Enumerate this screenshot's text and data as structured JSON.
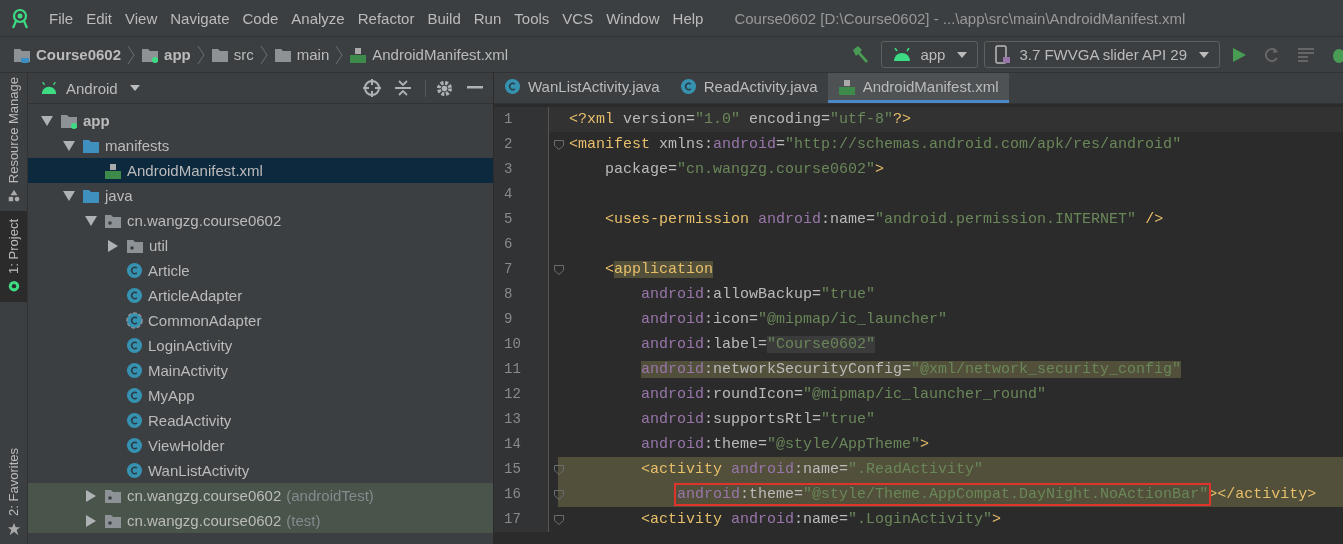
{
  "menu_bar": {
    "items": [
      "File",
      "Edit",
      "View",
      "Navigate",
      "Code",
      "Analyze",
      "Refactor",
      "Build",
      "Run",
      "Tools",
      "VCS",
      "Window",
      "Help"
    ],
    "title": "Course0602 [D:\\Course0602] - ...\\app\\src\\main\\AndroidManifest.xml"
  },
  "nav_bar": {
    "breadcrumbs": [
      {
        "label": "Course0602",
        "kind": "project"
      },
      {
        "label": "app",
        "kind": "module"
      },
      {
        "label": "src",
        "kind": "folder"
      },
      {
        "label": "main",
        "kind": "folder"
      },
      {
        "label": "AndroidManifest.xml",
        "kind": "manifest"
      }
    ],
    "run_config": "app",
    "device": "3.7  FWVGA slider API 29"
  },
  "tool_strip": [
    {
      "label": "Resource Manage",
      "kind": "resources",
      "selected": false
    },
    {
      "label": "1: Project",
      "kind": "project",
      "selected": true
    },
    {
      "label": "2: Favorites",
      "kind": "favorites",
      "selected": false
    }
  ],
  "project_panel": {
    "view": "Android",
    "tree": [
      {
        "label": "app",
        "kind": "module",
        "expanded": true,
        "selected": false,
        "test_scope": false,
        "children": [
          {
            "label": "manifests",
            "kind": "folder",
            "expanded": true,
            "selected": false,
            "test_scope": false,
            "children": [
              {
                "label": "AndroidManifest.xml",
                "kind": "manifest",
                "selected": true,
                "test_scope": false
              }
            ]
          },
          {
            "label": "java",
            "kind": "folder",
            "expanded": true,
            "selected": false,
            "test_scope": false,
            "children": [
              {
                "label": "cn.wangzg.course0602",
                "kind": "package",
                "expanded": true,
                "selected": false,
                "test_scope": false,
                "children": [
                  {
                    "label": "util",
                    "kind": "package",
                    "expanded": false,
                    "selected": false,
                    "test_scope": false
                  },
                  {
                    "label": "Article",
                    "kind": "class",
                    "selected": false,
                    "test_scope": false
                  },
                  {
                    "label": "ArticleAdapter",
                    "kind": "class",
                    "selected": false,
                    "test_scope": false
                  },
                  {
                    "label": "CommonAdapter",
                    "kind": "abstract-class",
                    "selected": false,
                    "test_scope": false
                  },
                  {
                    "label": "LoginActivity",
                    "kind": "class",
                    "selected": false,
                    "test_scope": false
                  },
                  {
                    "label": "MainActivity",
                    "kind": "class",
                    "selected": false,
                    "test_scope": false
                  },
                  {
                    "label": "MyApp",
                    "kind": "class",
                    "selected": false,
                    "test_scope": false
                  },
                  {
                    "label": "ReadActivity",
                    "kind": "class",
                    "selected": false,
                    "test_scope": false
                  },
                  {
                    "label": "ViewHolder",
                    "kind": "class",
                    "selected": false,
                    "test_scope": false
                  },
                  {
                    "label": "WanListActivity",
                    "kind": "class",
                    "selected": false,
                    "test_scope": false
                  }
                ]
              },
              {
                "label": "cn.wangzg.course0602",
                "suffix": "(androidTest)",
                "kind": "package",
                "expanded": false,
                "selected": false,
                "test_scope": true
              },
              {
                "label": "cn.wangzg.course0602",
                "suffix": "(test)",
                "kind": "package",
                "expanded": false,
                "selected": false,
                "test_scope": true
              }
            ]
          }
        ]
      }
    ]
  },
  "editor": {
    "tabs": [
      {
        "label": "WanListActivity.java",
        "kind": "class",
        "selected": false
      },
      {
        "label": "ReadActivity.java",
        "kind": "class",
        "selected": false
      },
      {
        "label": "AndroidManifest.xml",
        "kind": "manifest",
        "selected": true
      }
    ],
    "lines": [
      {
        "number": "1",
        "fold": false,
        "highlighted": false,
        "tokens": [
          {
            "text": "<?xml ",
            "kind": "plain"
          },
          {
            "text": "version=",
            "kind": "attr"
          },
          {
            "text": "\"1.0\" ",
            "kind": "value"
          },
          {
            "text": "encoding=",
            "kind": "attr"
          },
          {
            "text": "\"utf-8\"",
            "kind": "value"
          },
          {
            "text": "?>",
            "kind": "plain"
          }
        ]
      },
      {
        "number": "2",
        "fold": true,
        "highlighted": false,
        "tokens": [
          {
            "text": "<manifest ",
            "kind": "tag"
          },
          {
            "text": "xmlns:",
            "kind": "attr"
          },
          {
            "text": "android",
            "kind": "ns"
          },
          {
            "text": "=",
            "kind": "attr"
          },
          {
            "text": "\"http://schemas.android.com/apk/res/android\"",
            "kind": "value"
          }
        ]
      },
      {
        "number": "3",
        "fold": false,
        "highlighted": false,
        "tokens": [
          {
            "text": "    package=",
            "kind": "attr"
          },
          {
            "text": "\"cn.wangzg.course0602\"",
            "kind": "value"
          },
          {
            "text": ">",
            "kind": "tag"
          }
        ]
      },
      {
        "number": "4",
        "fold": false,
        "highlighted": false
      },
      {
        "number": "5",
        "fold": false,
        "highlighted": false,
        "tokens": [
          {
            "text": "    <uses-permission ",
            "kind": "tag"
          },
          {
            "text": "android",
            "kind": "ns"
          },
          {
            "text": ":name=",
            "kind": "attr"
          },
          {
            "text": "\"android.permission.INTERNET\" ",
            "kind": "value"
          },
          {
            "text": "/>",
            "kind": "tag"
          }
        ]
      },
      {
        "number": "6",
        "fold": false,
        "highlighted": false
      },
      {
        "number": "7",
        "fold": true,
        "highlighted": false,
        "tokens": [
          {
            "text": "    <",
            "kind": "tag"
          },
          {
            "text": "application",
            "kind": "tag",
            "highlighted": true
          }
        ]
      },
      {
        "number": "8",
        "fold": false,
        "highlighted": false,
        "tokens": [
          {
            "text": "        android",
            "kind": "ns"
          },
          {
            "text": ":allowBackup=",
            "kind": "attr"
          },
          {
            "text": "\"true\"",
            "kind": "value"
          }
        ]
      },
      {
        "number": "9",
        "fold": false,
        "highlighted": false,
        "tokens": [
          {
            "text": "        android",
            "kind": "ns"
          },
          {
            "text": ":icon=",
            "kind": "attr"
          },
          {
            "text": "\"@mipmap/ic_launcher\"",
            "kind": "value"
          }
        ]
      },
      {
        "number": "10",
        "fold": false,
        "highlighted": false,
        "tokens": [
          {
            "text": "        android",
            "kind": "ns"
          },
          {
            "text": ":label=",
            "kind": "attr"
          },
          {
            "text": "\"Course0602\"",
            "kind": "value",
            "shaded": true
          }
        ]
      },
      {
        "number": "11",
        "fold": false,
        "highlighted": false,
        "tokens": [
          {
            "text": "        android",
            "kind": "ns",
            "highlighted": true
          },
          {
            "text": ":networkSecurityConfig=",
            "kind": "attr",
            "highlighted": true
          },
          {
            "text": "\"@xml/network_security_config\"",
            "kind": "value",
            "highlighted": true
          }
        ]
      },
      {
        "number": "12",
        "fold": false,
        "highlighted": false,
        "tokens": [
          {
            "text": "        android",
            "kind": "ns"
          },
          {
            "text": ":roundIcon=",
            "kind": "attr"
          },
          {
            "text": "\"@mipmap/ic_launcher_round\"",
            "kind": "value"
          }
        ]
      },
      {
        "number": "13",
        "fold": false,
        "highlighted": false,
        "tokens": [
          {
            "text": "        android",
            "kind": "ns"
          },
          {
            "text": ":supportsRtl=",
            "kind": "attr"
          },
          {
            "text": "\"true\"",
            "kind": "value"
          }
        ]
      },
      {
        "number": "14",
        "fold": false,
        "highlighted": false,
        "tokens": [
          {
            "text": "        android",
            "kind": "ns"
          },
          {
            "text": ":theme=",
            "kind": "attr"
          },
          {
            "text": "\"@style/AppTheme\"",
            "kind": "value"
          },
          {
            "text": ">",
            "kind": "tag"
          }
        ]
      },
      {
        "number": "15",
        "fold": true,
        "highlighted": true,
        "tokens": [
          {
            "text": "        <activity ",
            "kind": "tag"
          },
          {
            "text": "android",
            "kind": "ns"
          },
          {
            "text": ":name=",
            "kind": "attr"
          },
          {
            "text": "\".ReadActivity\"",
            "kind": "value"
          }
        ]
      },
      {
        "number": "16",
        "fold": true,
        "highlighted": true,
        "tokens": [
          {
            "text": "            android",
            "kind": "ns",
            "boxed": true
          },
          {
            "text": ":theme=",
            "kind": "attr",
            "boxed": true
          },
          {
            "text": "\"@style/Theme.AppCompat.DayNight.NoActionBar\"",
            "kind": "value",
            "boxed": true
          },
          {
            "text": "></activity>",
            "kind": "tag"
          }
        ]
      },
      {
        "number": "17",
        "fold": true,
        "highlighted": false,
        "tokens": [
          {
            "text": "        <activity ",
            "kind": "tag"
          },
          {
            "text": "android",
            "kind": "ns"
          },
          {
            "text": ":name=",
            "kind": "attr"
          },
          {
            "text": "\".LoginActivity\"",
            "kind": "value"
          },
          {
            "text": ">",
            "kind": "tag"
          }
        ]
      }
    ]
  }
}
